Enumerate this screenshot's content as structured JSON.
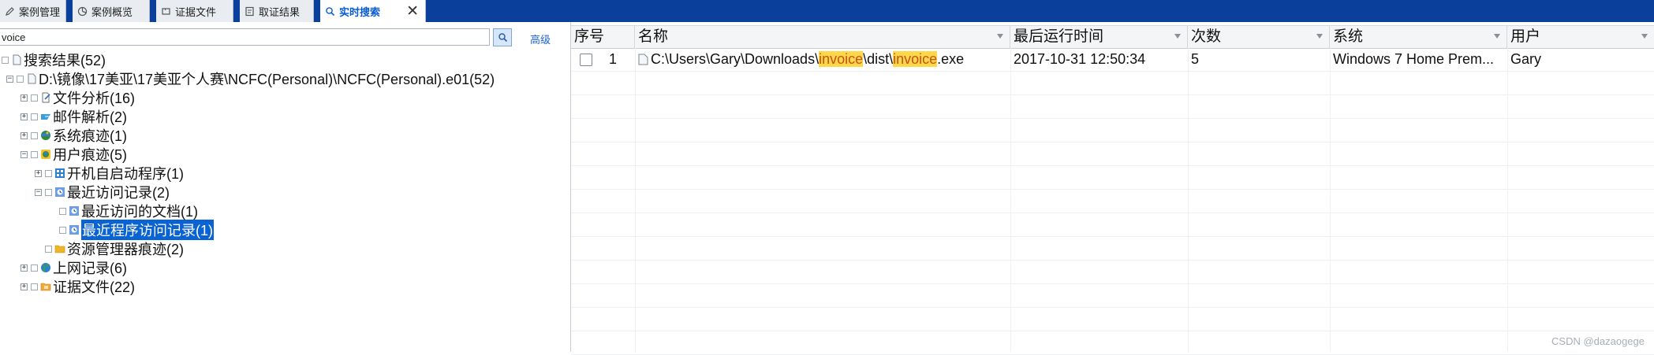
{
  "tabs": [
    {
      "label": "案例管理",
      "icon": "edit-icon"
    },
    {
      "label": "案例概览",
      "icon": "pie-icon"
    },
    {
      "label": "证据文件",
      "icon": "file-icon"
    },
    {
      "label": "取证结果",
      "icon": "report-icon"
    },
    {
      "label": "实时搜索",
      "icon": "search-icon",
      "active": true
    }
  ],
  "close_label": "✕",
  "search": {
    "value": "voice",
    "advanced": "高级"
  },
  "tree": [
    {
      "label": "搜索结果(52)",
      "icon": "doc-icon"
    },
    {
      "label": "D:\\镜像\\17美亚\\17美亚个人赛\\NCFC(Personal)\\NCFC(Personal).e01(52)",
      "icon": "doc-icon"
    },
    {
      "label": "文件分析(16)",
      "icon": "file-analysis-icon"
    },
    {
      "label": "邮件解析(2)",
      "icon": "mail-icon"
    },
    {
      "label": "系统痕迹(1)",
      "icon": "system-icon"
    },
    {
      "label": "用户痕迹(5)",
      "icon": "user-icon"
    },
    {
      "label": "开机自启动程序(1)",
      "icon": "startup-icon"
    },
    {
      "label": "最近访问记录(2)",
      "icon": "recent-icon"
    },
    {
      "label": "最近访问的文档(1)",
      "icon": "recent-doc-icon"
    },
    {
      "label": "最近程序访问记录(1)",
      "icon": "recent-program-icon",
      "selected": true
    },
    {
      "label": "资源管理器痕迹(2)",
      "icon": "folder-icon"
    },
    {
      "label": "上网记录(6)",
      "icon": "globe-icon"
    },
    {
      "label": "证据文件(22)",
      "icon": "evidence-folder-icon"
    }
  ],
  "grid": {
    "columns": [
      "序号",
      "名称",
      "最后运行时间",
      "次数",
      "系统",
      "用户"
    ],
    "rows": [
      {
        "index": "1",
        "name_parts": [
          "C:\\Users\\Gary\\Downloads\\",
          "invoice",
          "\\dist\\",
          "invoice",
          ".exe"
        ],
        "last_run": "2017-10-31 12:50:34",
        "count": "5",
        "system": "Windows 7 Home Prem...",
        "user": "Gary"
      }
    ]
  },
  "watermark": "CSDN @dazaogege",
  "colors": {
    "titlebar": "#0a3f9c",
    "highlight": "#ffd84a",
    "selection": "#0a63d3",
    "link": "#1c64d4"
  }
}
